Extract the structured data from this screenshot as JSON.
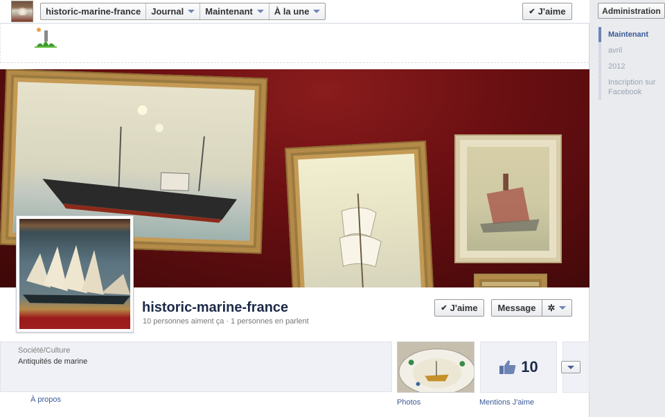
{
  "topbar": {
    "page_name": "historic-marine-france",
    "nav": [
      {
        "label": "historic-marine-france",
        "has_caret": false
      },
      {
        "label": "Journal",
        "has_caret": true
      },
      {
        "label": "Maintenant",
        "has_caret": true
      },
      {
        "label": "À la une",
        "has_caret": true
      }
    ],
    "like_label": "J'aime"
  },
  "profile": {
    "name": "historic-marine-france",
    "stats": "10 personnes aiment ça · 1 personnes en parlent",
    "like_label": "J'aime",
    "message_label": "Message"
  },
  "about": {
    "category": "Société/Culture",
    "description": "Antiquités de marine",
    "link_label": "À propos"
  },
  "apps": {
    "photos_label": "Photos",
    "likes_label": "Mentions J'aime",
    "likes_count": "10"
  },
  "sidebar": {
    "admin_label": "Administration",
    "timeline": [
      {
        "label": "Maintenant",
        "active": true
      },
      {
        "label": "avril",
        "active": false
      },
      {
        "label": "2012",
        "active": false
      },
      {
        "label": "Inscription sur Facebook",
        "active": false
      }
    ]
  },
  "colors": {
    "link": "#3b5998",
    "accent": "#6d84b4",
    "cover_wall": "#6a0f12"
  }
}
